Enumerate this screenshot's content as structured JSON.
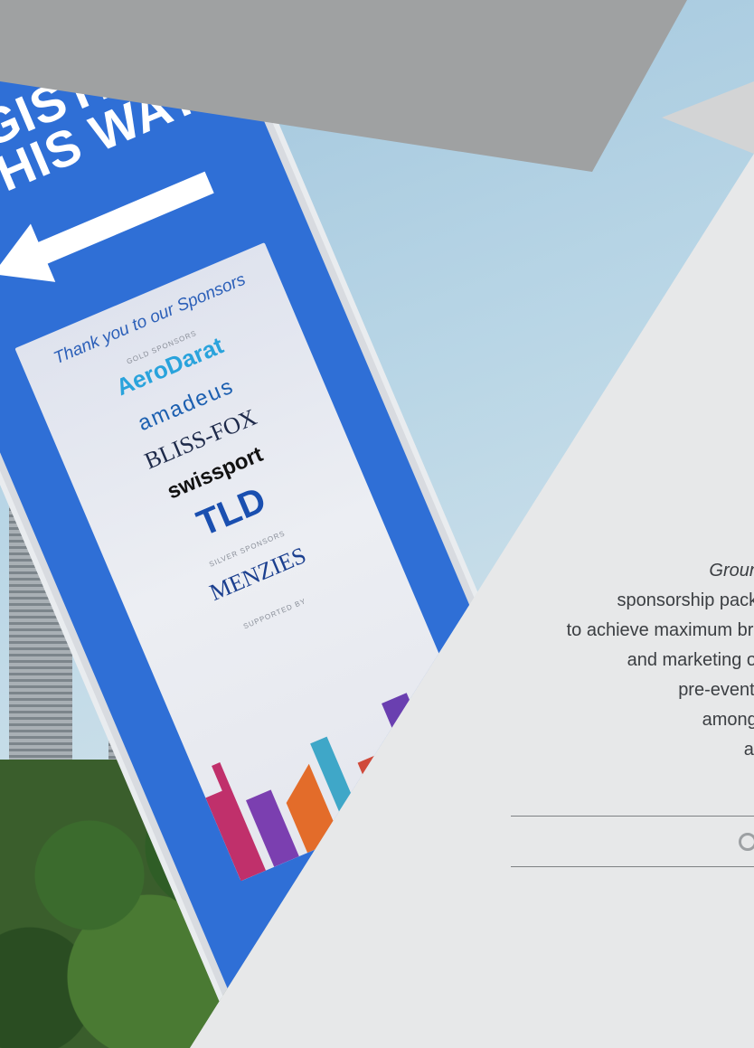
{
  "banner": {
    "headline_line1": "REGISTRATION",
    "headline_line2": "THIS WAY",
    "thanks": "Thank you to our Sponsors",
    "sponsors": {
      "aerodarat": "AeroDarat",
      "amadeus": "amadeus",
      "bliss_fox": "BLISS-FOX",
      "swissport": "swissport",
      "tld": "TLD",
      "menzies": "MENZIES"
    },
    "tiers": {
      "gold": "GOLD SPONSORS",
      "silver": "SILVER SPONSORS",
      "supported": "SUPPORTED BY"
    }
  },
  "copy": {
    "line1": "Ground Handling",
    "line2": "sponsorship packages",
    "line3": "to achieve maximum br",
    "line4": "and marketing oppo",
    "line5": "pre-event commu",
    "line6": "among this impo",
    "line7": "audience at t"
  },
  "colors": {
    "banner_blue": "#2f6fd6",
    "background_grey": "#e7e8e9",
    "top_band_grey": "#9fa1a2",
    "text": "#3b3e42"
  }
}
